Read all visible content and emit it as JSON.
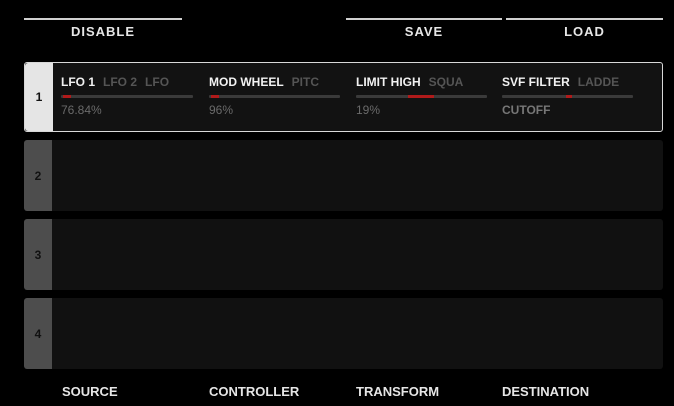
{
  "header": {
    "disable_label": "DISABLE",
    "save_label": "SAVE",
    "load_label": "LOAD"
  },
  "slots": [
    {
      "number": "1",
      "source": {
        "selected": "LFO 1",
        "next": "LFO 2",
        "next2": "LFO",
        "value": "76.84%",
        "level": 0.04
      },
      "controller": {
        "selected": "MOD WHEEL",
        "next": "PITC",
        "value": "96%",
        "level": 0.04
      },
      "transform": {
        "selected": "LIMIT HIGH",
        "next": "SQUA",
        "value": "19%",
        "level": 0.5
      },
      "destination": {
        "selected": "SVF FILTER",
        "next": "LADDE",
        "value": "CUTOFF",
        "level": 0.5
      }
    },
    {
      "number": "2"
    },
    {
      "number": "3"
    },
    {
      "number": "4"
    }
  ],
  "footer": {
    "source": "SOURCE",
    "controller": "CONTROLLER",
    "transform": "TRANSFORM",
    "destination": "DESTINATION"
  },
  "colors": {
    "accent": "#b01a1a",
    "background": "#000000"
  }
}
